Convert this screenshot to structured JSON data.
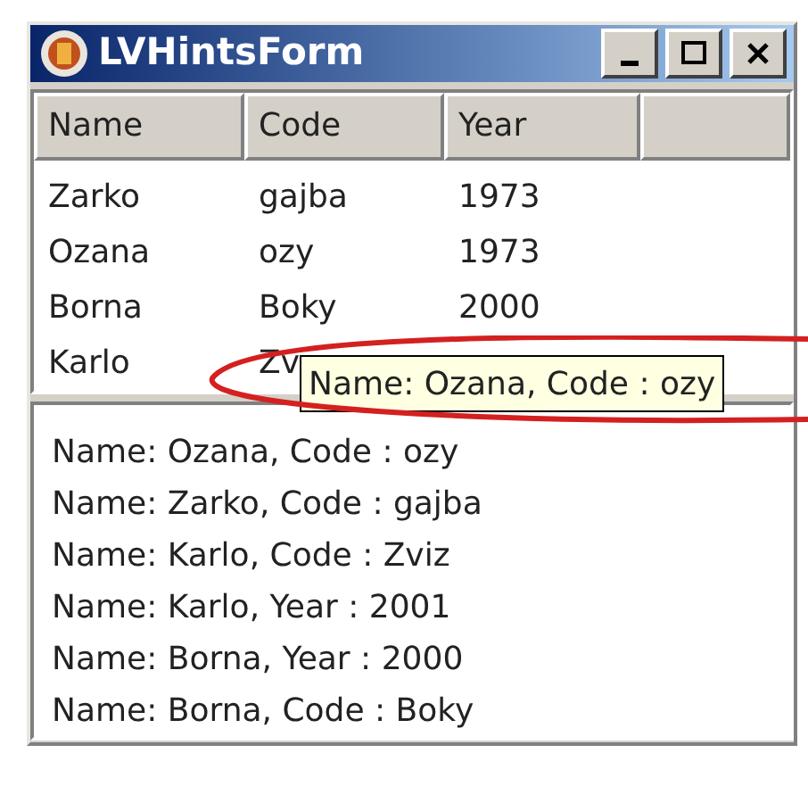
{
  "window": {
    "title": "LVHintsForm"
  },
  "list_view": {
    "columns": [
      "Name",
      "Code",
      "Year"
    ],
    "rows": [
      [
        "Zarko",
        "gajba",
        "1973"
      ],
      [
        "Ozana",
        "ozy",
        "1973"
      ],
      [
        "Borna",
        "Boky",
        "2000"
      ],
      [
        "Karlo",
        "Zv"
      ]
    ]
  },
  "tooltip": {
    "text": "Name: Ozana, Code : ozy"
  },
  "log": [
    "Name: Ozana, Code : ozy",
    "Name: Zarko, Code : gajba",
    "Name: Karlo, Code : Zviz",
    "Name: Karlo, Year : 2001",
    "Name: Borna, Year : 2000",
    "Name: Borna, Code : Boky"
  ]
}
